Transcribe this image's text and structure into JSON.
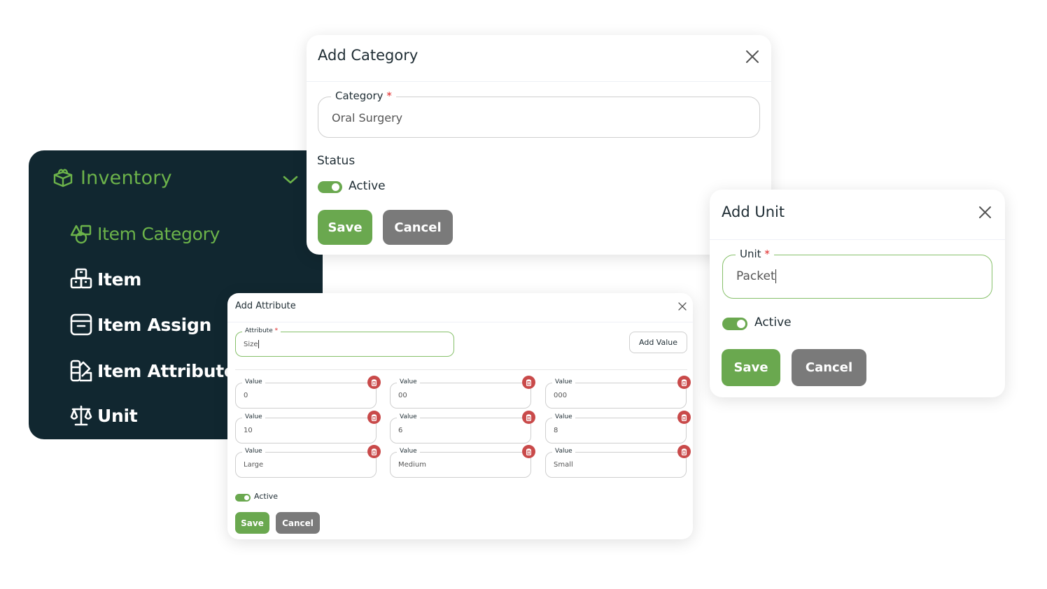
{
  "sidebar": {
    "header": {
      "label": "Inventory",
      "icon": "package-icon"
    },
    "items": [
      {
        "label": "Item Category",
        "icon": "shapes-icon",
        "active": true
      },
      {
        "label": "Item",
        "icon": "boxes-icon",
        "active": false
      },
      {
        "label": "Item Assign",
        "icon": "archive-icon",
        "active": false
      },
      {
        "label": "Item Attribute",
        "icon": "swatch-icon",
        "active": false
      },
      {
        "label": "Unit",
        "icon": "scale-icon",
        "active": false
      }
    ]
  },
  "category_modal": {
    "title": "Add Category",
    "field_label": "Category",
    "required_mark": "*",
    "field_value": "Oral Surgery",
    "status_label": "Status",
    "toggle_label": "Active",
    "toggle_on": true,
    "save_label": "Save",
    "cancel_label": "Cancel"
  },
  "unit_modal": {
    "title": "Add Unit",
    "field_label": "Unit",
    "required_mark": "*",
    "field_value": "Packet",
    "toggle_label": "Active",
    "toggle_on": true,
    "save_label": "Save",
    "cancel_label": "Cancel"
  },
  "attribute_modal": {
    "title": "Add Attribute",
    "field_label": "Attribute",
    "required_mark": "*",
    "field_value": "Size",
    "add_value_label": "Add Value",
    "value_label": "Value",
    "values": [
      "0",
      "00",
      "000",
      "10",
      "6",
      "8",
      "Large",
      "Medium",
      "Small"
    ],
    "toggle_label": "Active",
    "toggle_on": true,
    "save_label": "Save",
    "cancel_label": "Cancel"
  },
  "colors": {
    "brand_green": "#6aa84f",
    "sidebar_bg": "#112730",
    "sidebar_active": "#6cb34a",
    "cancel_gray": "#7a7a7a",
    "delete_red": "#c94a4a"
  }
}
